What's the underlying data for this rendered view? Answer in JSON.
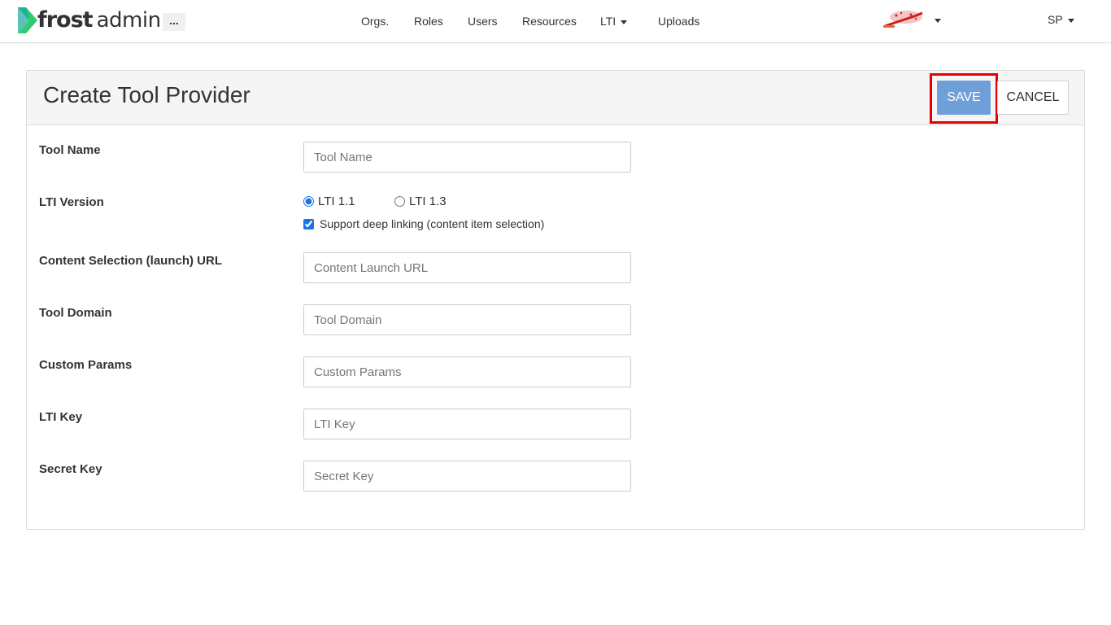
{
  "app": {
    "logo_main": "frost",
    "logo_sub": "admin",
    "more_label": "..."
  },
  "nav": {
    "items": [
      {
        "label": "Orgs."
      },
      {
        "label": "Roles"
      },
      {
        "label": "Users"
      },
      {
        "label": "Resources"
      },
      {
        "label": "LTI",
        "dropdown": true
      },
      {
        "label": "Uploads"
      }
    ],
    "user_initials": "SP"
  },
  "page": {
    "title": "Create Tool Provider",
    "save_label": "SAVE",
    "cancel_label": "CANCEL"
  },
  "form": {
    "tool_name": {
      "label": "Tool Name",
      "value": "",
      "placeholder": "Tool Name"
    },
    "lti_version": {
      "label": "LTI Version",
      "options": [
        {
          "label": "LTI 1.1",
          "selected": true
        },
        {
          "label": "LTI 1.3",
          "selected": false
        }
      ],
      "deep_linking_label": "Support deep linking (content item selection)",
      "deep_linking_checked": true
    },
    "launch_url": {
      "label": "Content Selection (launch) URL",
      "value": "",
      "placeholder": "Content Launch URL"
    },
    "tool_domain": {
      "label": "Tool Domain",
      "value": "",
      "placeholder": "Tool Domain"
    },
    "custom_params": {
      "label": "Custom Params",
      "value": "",
      "placeholder": "Custom Params"
    },
    "lti_key": {
      "label": "LTI Key",
      "value": "",
      "placeholder": "LTI Key"
    },
    "secret_key": {
      "label": "Secret Key",
      "value": "",
      "placeholder": "Secret Key"
    }
  },
  "colors": {
    "brand_green": "#2ecc71",
    "save_button": "#6f9fd8",
    "highlight": "#e60000"
  },
  "icons": {
    "logo": "frost-chevron-logo",
    "org": "org-logo",
    "caret": "caret-down-icon"
  }
}
